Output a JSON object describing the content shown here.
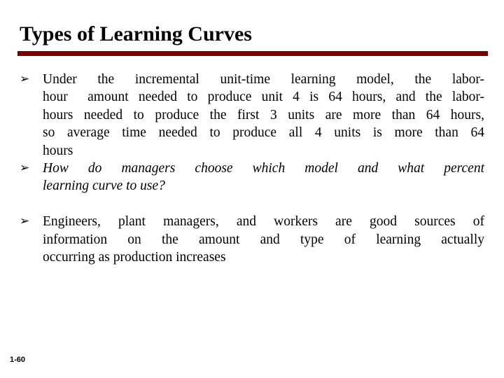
{
  "slide": {
    "title": "Types of Learning Curves",
    "rule_color": "#7B0000",
    "background_color": "#FFFFFF",
    "text_color": "#000000",
    "slide_number": "1-60"
  },
  "bullets": [
    {
      "marker": "➢",
      "style": "normal",
      "text": "Under the incremental unit-time learning model, the labor-hour  amount needed to produce unit 4 is 64 hours, and the labor-hours needed to produce the first 3 units are more than 64 hours, so average time needed to produce all 4 units is more than 64 hours",
      "lines": [
        "Under  the  incremental  unit-time  learning  model,  the  labor-",
        "hour  amount needed to produce unit 4 is 64 hours, and the labor-",
        "hours needed to produce the first 3 units are more than 64 hours,",
        "so  average  time  needed  to  produce  all  4  units  is  more  than  64",
        "hours"
      ]
    },
    {
      "marker": "➢",
      "style": "italic",
      "text": "How do managers choose which model and what percent learning curve to use?",
      "lines": [
        "How  do  managers  choose  which  model  and  what  percent",
        "learning curve to use?"
      ]
    },
    {
      "marker": "➢",
      "style": "normal",
      "spacer_before": true,
      "text": "Engineers, plant managers, and workers are good sources of information on the amount and type of learning actually occurring as production increases",
      "lines": [
        "Engineers,  plant  managers,  and  workers  are  good  sources  of",
        "information  on  the  amount  and  type  of  learning  actually",
        "occurring as production increases"
      ]
    }
  ]
}
